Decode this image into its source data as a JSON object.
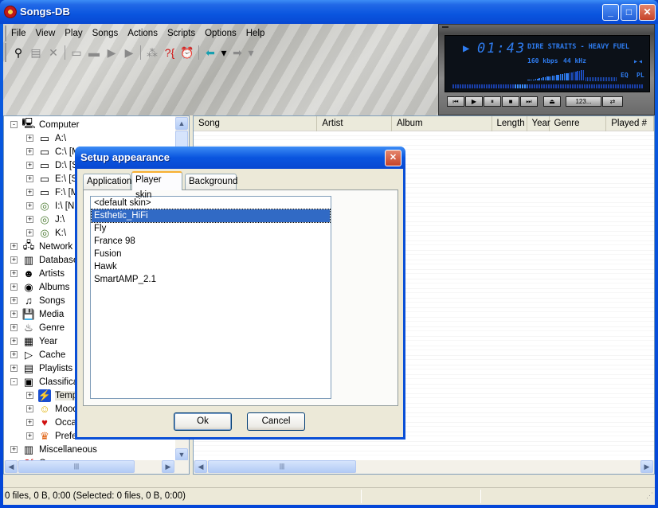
{
  "window": {
    "title": "Songs-DB",
    "controls": {
      "minimize": "_",
      "maximize": "□",
      "close": "✕"
    }
  },
  "menu": [
    "File",
    "View",
    "Play",
    "Songs",
    "Actions",
    "Scripts",
    "Options",
    "Help"
  ],
  "toolbar": [
    {
      "icon": "binoculars-icon",
      "glyph": "⚲",
      "enabled": true
    },
    {
      "icon": "properties-icon",
      "glyph": "▤",
      "enabled": false
    },
    {
      "icon": "delete-icon",
      "glyph": "✕",
      "enabled": false
    },
    {
      "sep": true
    },
    {
      "icon": "playlist-icon",
      "glyph": "▭",
      "enabled": false
    },
    {
      "icon": "playlist-add-icon",
      "glyph": "▬",
      "enabled": false
    },
    {
      "icon": "play-icon",
      "glyph": "▶",
      "enabled": false
    },
    {
      "icon": "play-next-icon",
      "glyph": "▶",
      "enabled": false
    },
    {
      "sep": true
    },
    {
      "icon": "wand-icon",
      "glyph": "⁂",
      "enabled": false
    },
    {
      "icon": "query-icon",
      "glyph": "?{",
      "enabled": true
    },
    {
      "icon": "alarm-clock-icon",
      "glyph": "⏰",
      "enabled": true
    },
    {
      "sep": true
    },
    {
      "icon": "back-arrow-icon",
      "glyph": "⬅",
      "enabled": true
    },
    {
      "icon": "back-dropdown-icon",
      "glyph": "▾",
      "enabled": true
    },
    {
      "icon": "forward-arrow-icon",
      "glyph": "➡",
      "enabled": false
    },
    {
      "icon": "forward-dropdown-icon",
      "glyph": "▾",
      "enabled": false
    }
  ],
  "player": {
    "time": "01:43",
    "track": "DIRE STRAITS - HEAVY FUEL",
    "bitrate": "160 kbps",
    "samplerate": "44 kHz",
    "eq_label": "EQ",
    "pl_label": "PL",
    "buttons": [
      "⏮",
      "▶",
      "⏸",
      "■",
      "⏭",
      "⏏",
      "123...",
      "⇄"
    ]
  },
  "tree": {
    "items": [
      {
        "label": "Computer",
        "expander": "-",
        "icon": "computer-icon",
        "glyph": "🖳",
        "level": 0
      },
      {
        "label": "A:\\",
        "expander": "+",
        "icon": "floppy-drive-icon",
        "glyph": "▭",
        "level": 1
      },
      {
        "label": "C:\\ [M",
        "expander": "+",
        "icon": "hard-drive-icon",
        "glyph": "▭",
        "level": 1
      },
      {
        "label": "D:\\ [S",
        "expander": "+",
        "icon": "hard-drive-icon",
        "glyph": "▭",
        "level": 1
      },
      {
        "label": "E:\\ [S",
        "expander": "+",
        "icon": "hard-drive-icon",
        "glyph": "▭",
        "level": 1
      },
      {
        "label": "F:\\ [M",
        "expander": "+",
        "icon": "hard-drive-icon",
        "glyph": "▭",
        "level": 1
      },
      {
        "label": "I:\\ [N",
        "expander": "+",
        "icon": "cd-drive-icon",
        "glyph": "◎",
        "level": 1
      },
      {
        "label": "J:\\",
        "expander": "+",
        "icon": "cd-drive-icon",
        "glyph": "◎",
        "level": 1
      },
      {
        "label": "K:\\",
        "expander": "+",
        "icon": "cd-drive-icon",
        "glyph": "◎",
        "level": 1
      },
      {
        "label": "Network",
        "expander": "+",
        "icon": "network-icon",
        "glyph": "🖧",
        "level": 0
      },
      {
        "label": "Database",
        "expander": "+",
        "icon": "database-icon",
        "glyph": "▥",
        "level": 0
      },
      {
        "label": "Artists",
        "expander": "+",
        "icon": "artists-icon",
        "glyph": "☻",
        "level": 0
      },
      {
        "label": "Albums",
        "expander": "+",
        "icon": "albums-icon",
        "glyph": "◉",
        "level": 0
      },
      {
        "label": "Songs",
        "expander": "+",
        "icon": "songs-icon",
        "glyph": "♫",
        "level": 0
      },
      {
        "label": "Media",
        "expander": "+",
        "icon": "media-icon",
        "glyph": "💾",
        "level": 0
      },
      {
        "label": "Genre",
        "expander": "+",
        "icon": "genre-icon",
        "glyph": "♨",
        "level": 0
      },
      {
        "label": "Year",
        "expander": "+",
        "icon": "calendar-icon",
        "glyph": "▦",
        "level": 0
      },
      {
        "label": "Cache",
        "expander": "+",
        "icon": "cache-icon",
        "glyph": "▷",
        "level": 0
      },
      {
        "label": "Playlists",
        "expander": "+",
        "icon": "playlists-icon",
        "glyph": "▤",
        "level": 0
      },
      {
        "label": "Classificat",
        "expander": "-",
        "icon": "classification-icon",
        "glyph": "▣",
        "level": 0
      },
      {
        "label": "Temp",
        "expander": "+",
        "icon": "tempo-icon",
        "glyph": "⚡",
        "level": 1
      },
      {
        "label": "Mood",
        "expander": "+",
        "icon": "mood-icon",
        "glyph": "☺",
        "level": 1
      },
      {
        "label": "Occa",
        "expander": "+",
        "icon": "occasion-icon",
        "glyph": "♥",
        "level": 1
      },
      {
        "label": "Prefe",
        "expander": "+",
        "icon": "preference-icon",
        "glyph": "♛",
        "level": 1
      },
      {
        "label": "Miscellaneous",
        "expander": "+",
        "icon": "miscellaneous-icon",
        "glyph": "▥",
        "level": 0
      },
      {
        "label": "Query",
        "expander": "",
        "icon": "query-icon",
        "glyph": "?{",
        "level": 0
      }
    ]
  },
  "list": {
    "columns": [
      "Song",
      "Artist",
      "Album",
      "Length",
      "Year",
      "Genre",
      "Played #"
    ]
  },
  "status": {
    "text": "0 files, 0 B, 0:00 (Selected: 0 files, 0 B, 0:00)"
  },
  "dialog": {
    "title": "Setup appearance",
    "tabs": [
      "Application",
      "Player skin",
      "Background"
    ],
    "active_tab": "Player skin",
    "skins": [
      "<default skin>",
      "Esthetic_HiFi",
      "Fly",
      "France 98",
      "Fusion",
      "Hawk",
      "SmartAMP_2.1"
    ],
    "selected_skin": "Esthetic_HiFi",
    "ok_label": "Ok",
    "cancel_label": "Cancel"
  },
  "colors": {
    "xp_blue": "#0a55df",
    "selection": "#316ac5",
    "lcd_text": "#2e7cf0",
    "face": "#ece9d8"
  }
}
